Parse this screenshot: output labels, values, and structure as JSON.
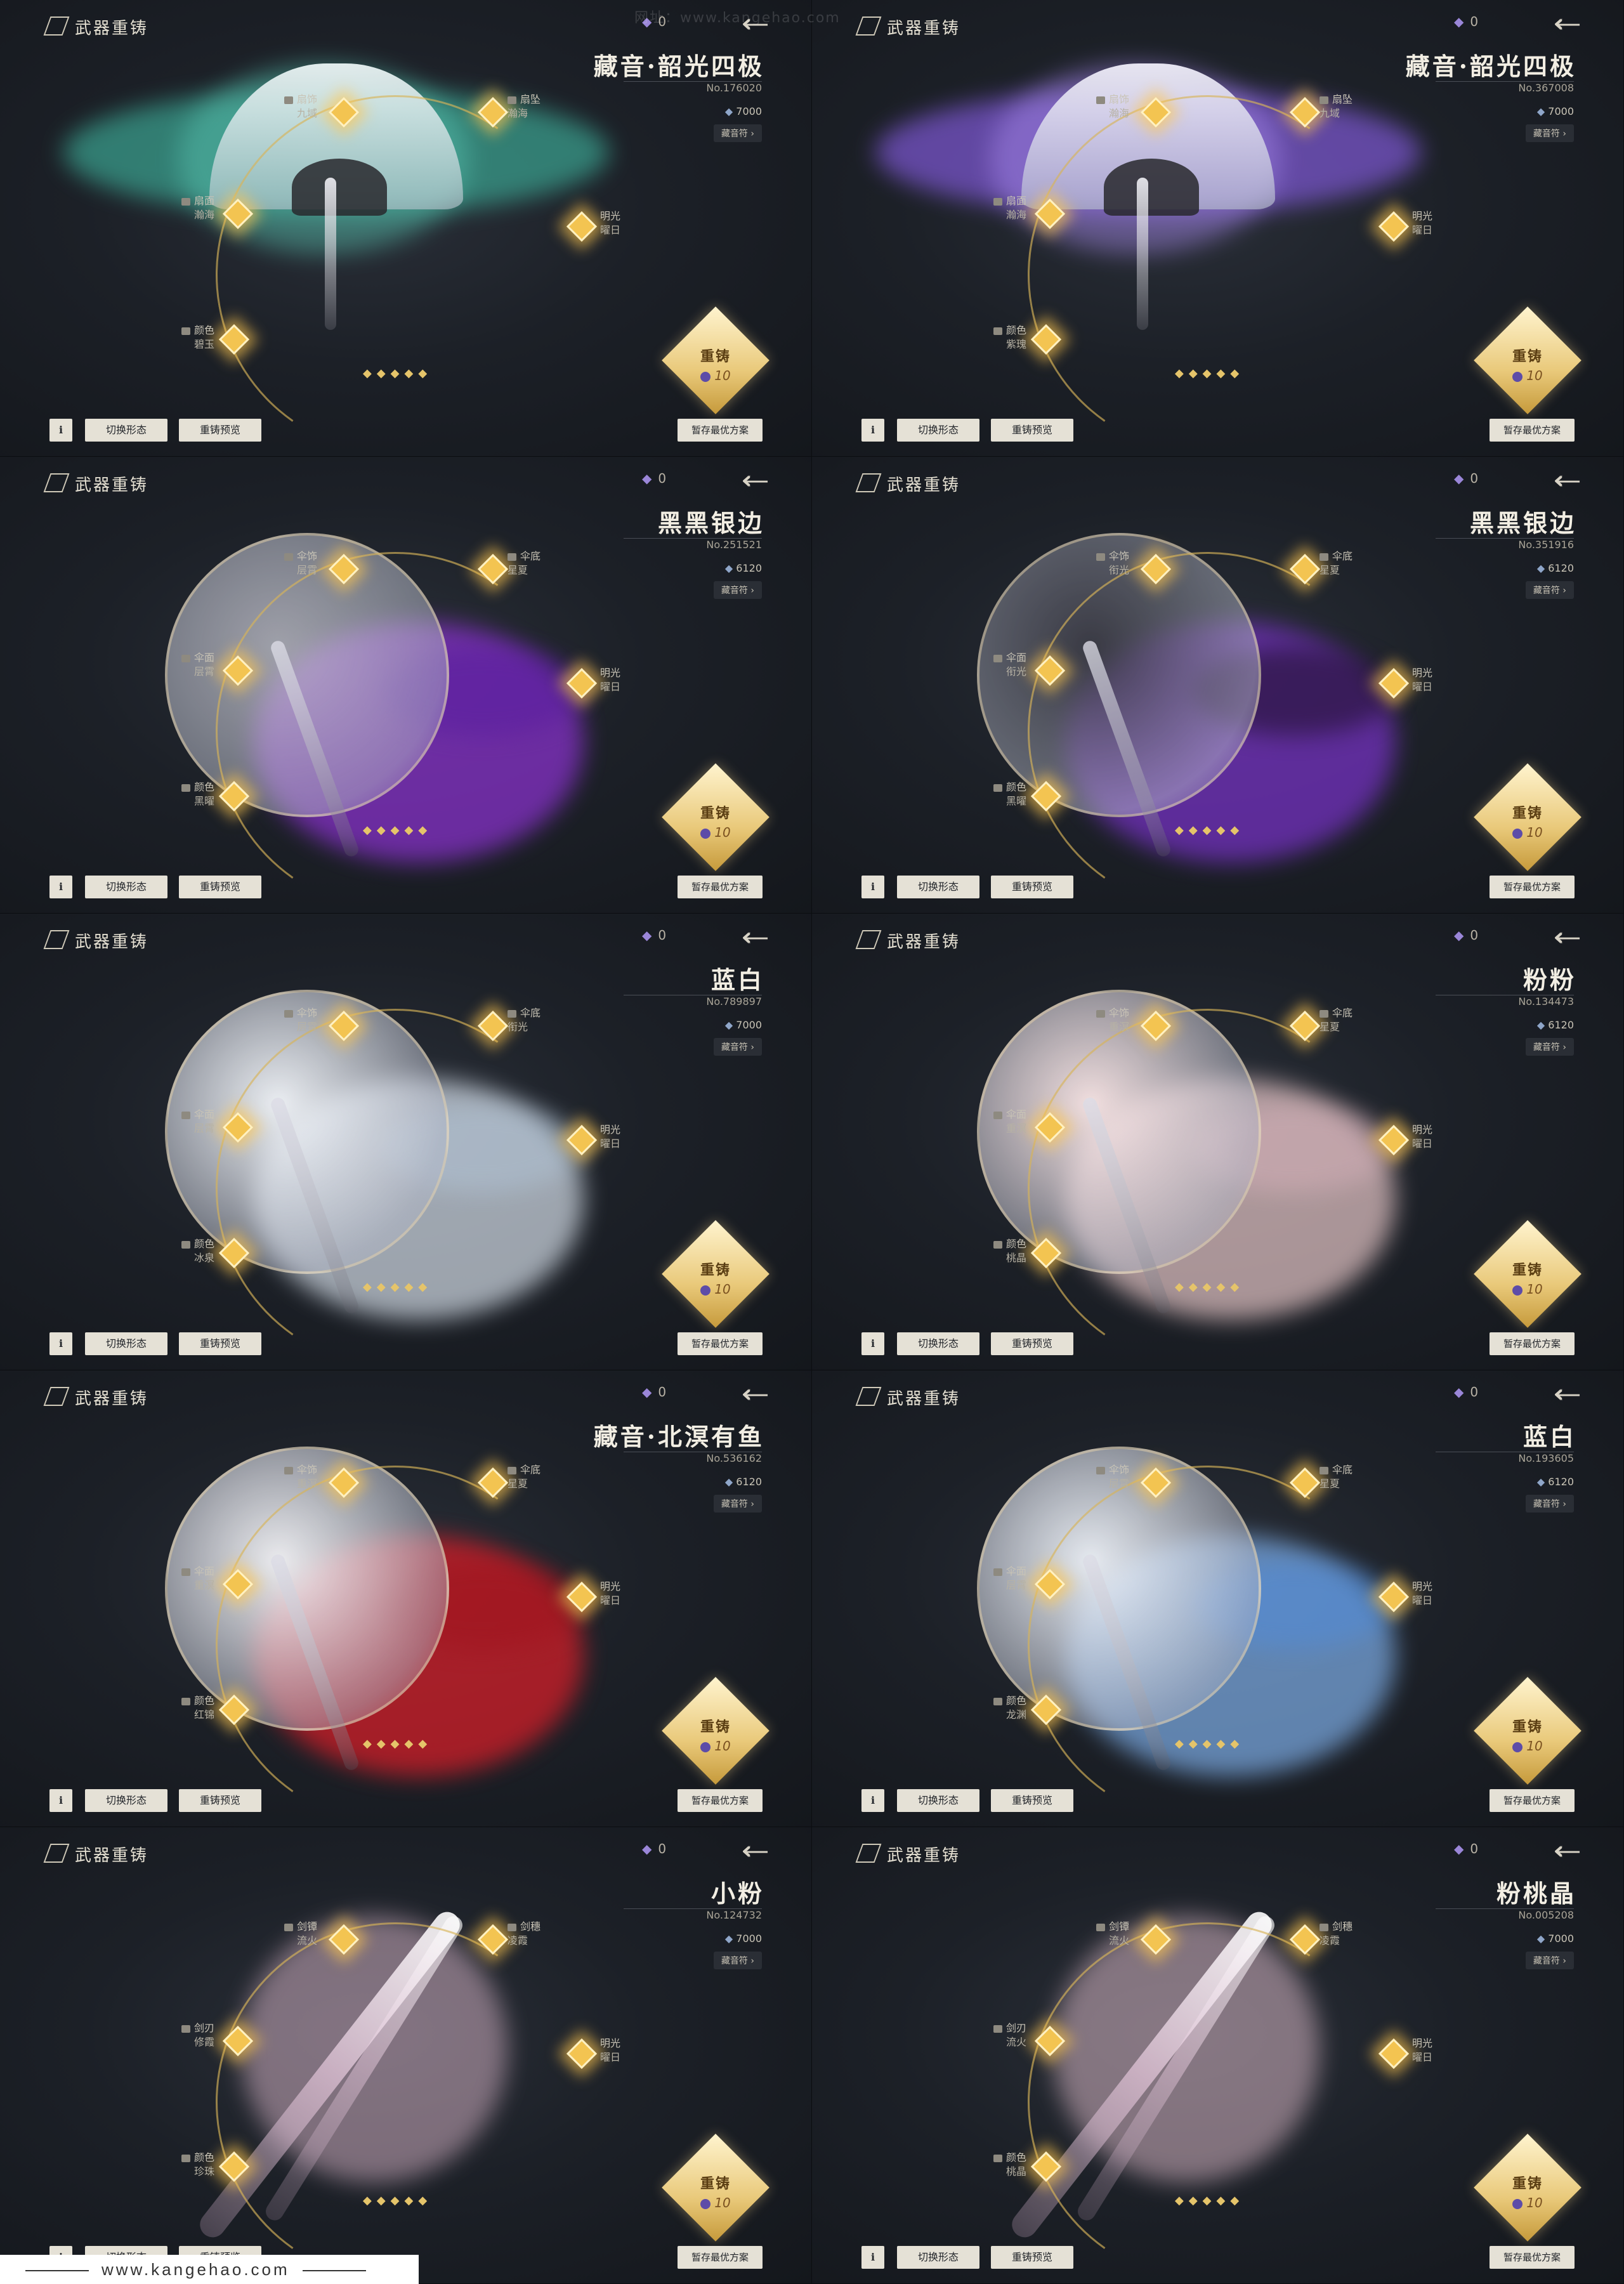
{
  "header": {
    "title": "武器重铸"
  },
  "reforge": {
    "label": "重铸",
    "cost": "10"
  },
  "buttons": {
    "info": "i",
    "switch": "切换形态",
    "preview": "重铸预览",
    "save": "暂存最优方案"
  },
  "watermark": {
    "top": "网址：www.kangehao.com",
    "footer": "www.kangehao.com"
  },
  "colors": {
    "accent_gold": "#f3c451",
    "bg": "#14171c",
    "button_bg": "#e5e1d6"
  },
  "panels": [
    {
      "name": "藏音·韶光四极",
      "no": "No.176020",
      "price": "7000",
      "tag": "藏音符 ›",
      "currency": "0",
      "labels": [
        {
          "k": "扇饰",
          "v": "九域"
        },
        {
          "k": "扇坠",
          "v": "瀚海"
        },
        {
          "k": "扇面",
          "v": "瀚海"
        },
        {
          "k": "颜色",
          "v": "碧玉"
        },
        {
          "k": "明光",
          "v": "曜日"
        }
      ],
      "art": "fan-green"
    },
    {
      "name": "藏音·韶光四极",
      "no": "No.367008",
      "price": "7000",
      "tag": "藏音符 ›",
      "currency": "0",
      "labels": [
        {
          "k": "扇饰",
          "v": "瀚海"
        },
        {
          "k": "扇坠",
          "v": "九域"
        },
        {
          "k": "扇面",
          "v": "瀚海"
        },
        {
          "k": "颜色",
          "v": "紫瑰"
        },
        {
          "k": "明光",
          "v": "曜日"
        }
      ],
      "art": "fan-purple"
    },
    {
      "name": "黑黑银边",
      "no": "No.251521",
      "price": "6120",
      "tag": "藏音符 ›",
      "currency": "0",
      "labels": [
        {
          "k": "伞饰",
          "v": "层霄"
        },
        {
          "k": "伞底",
          "v": "星夏"
        },
        {
          "k": "伞面",
          "v": "层霄"
        },
        {
          "k": "颜色",
          "v": "黑曜"
        },
        {
          "k": "明光",
          "v": "曜日"
        }
      ],
      "art": "umbrella-purple"
    },
    {
      "name": "黑黑银边",
      "no": "No.351916",
      "price": "6120",
      "tag": "藏音符 ›",
      "currency": "0",
      "labels": [
        {
          "k": "伞饰",
          "v": "衔光"
        },
        {
          "k": "伞底",
          "v": "星夏"
        },
        {
          "k": "伞面",
          "v": "衔光"
        },
        {
          "k": "颜色",
          "v": "黑曜"
        },
        {
          "k": "明光",
          "v": "曜日"
        }
      ],
      "art": "umbrella-black"
    },
    {
      "name": "蓝白",
      "no": "No.789897",
      "price": "7000",
      "tag": "藏音符 ›",
      "currency": "0",
      "labels": [
        {
          "k": "伞饰",
          "v": "层霄"
        },
        {
          "k": "伞底",
          "v": "衔光"
        },
        {
          "k": "伞面",
          "v": "层霄"
        },
        {
          "k": "颜色",
          "v": "冰泉"
        },
        {
          "k": "明光",
          "v": "曜日"
        }
      ],
      "art": "umbrella-white"
    },
    {
      "name": "粉粉",
      "no": "No.134473",
      "price": "6120",
      "tag": "藏音符 ›",
      "currency": "0",
      "labels": [
        {
          "k": "伞饰",
          "v": "重溟"
        },
        {
          "k": "伞底",
          "v": "星夏"
        },
        {
          "k": "伞面",
          "v": "重溟"
        },
        {
          "k": "颜色",
          "v": "桃晶"
        },
        {
          "k": "明光",
          "v": "曜日"
        }
      ],
      "art": "umbrella-pink"
    },
    {
      "name": "藏音·北溟有鱼",
      "no": "No.536162",
      "price": "6120",
      "tag": "藏音符 ›",
      "currency": "0",
      "labels": [
        {
          "k": "伞饰",
          "v": "重溟"
        },
        {
          "k": "伞底",
          "v": "星夏"
        },
        {
          "k": "伞面",
          "v": "重溟"
        },
        {
          "k": "颜色",
          "v": "红锦"
        },
        {
          "k": "明光",
          "v": "曜日"
        }
      ],
      "art": "umbrella-red"
    },
    {
      "name": "蓝白",
      "no": "No.193605",
      "price": "6120",
      "tag": "藏音符 ›",
      "currency": "0",
      "labels": [
        {
          "k": "伞饰",
          "v": "层霄"
        },
        {
          "k": "伞底",
          "v": "星夏"
        },
        {
          "k": "伞面",
          "v": "层霄"
        },
        {
          "k": "颜色",
          "v": "龙渊"
        },
        {
          "k": "明光",
          "v": "曜日"
        }
      ],
      "art": "umbrella-blue"
    },
    {
      "name": "小粉",
      "no": "No.124732",
      "price": "7000",
      "tag": "藏音符 ›",
      "currency": "0",
      "labels": [
        {
          "k": "剑镡",
          "v": "流火"
        },
        {
          "k": "剑穗",
          "v": "凌霞"
        },
        {
          "k": "剑刃",
          "v": "修霞"
        },
        {
          "k": "颜色",
          "v": "珍珠"
        },
        {
          "k": "明光",
          "v": "曜日"
        }
      ],
      "art": "sword-pink"
    },
    {
      "name": "粉桃晶",
      "no": "No.005208",
      "price": "7000",
      "tag": "藏音符 ›",
      "currency": "0",
      "labels": [
        {
          "k": "剑镡",
          "v": "流火"
        },
        {
          "k": "剑穗",
          "v": "凌霞"
        },
        {
          "k": "剑刃",
          "v": "流火"
        },
        {
          "k": "颜色",
          "v": "桃晶"
        },
        {
          "k": "明光",
          "v": "曜日"
        }
      ],
      "art": "sword-peach"
    }
  ]
}
